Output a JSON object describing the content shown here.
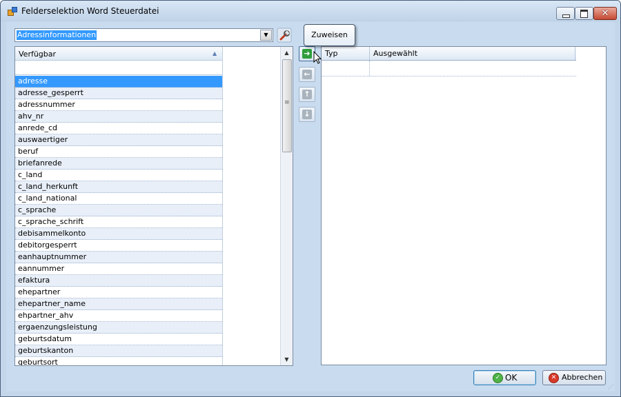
{
  "window": {
    "title": "Felderselektion Word Steuerdatei"
  },
  "combo": {
    "value": "Adressinformationen"
  },
  "list": {
    "header": "Verfügbar",
    "items": [
      "adresse",
      "adresse_gesperrt",
      "adressnummer",
      "ahv_nr",
      "anrede_cd",
      "auswaertiger",
      "beruf",
      "briefanrede",
      "c_land",
      "c_land_herkunft",
      "c_land_national",
      "c_sprache",
      "c_sprache_schrift",
      "debisammelkonto",
      "debitorgesperrt",
      "eanhauptnummer",
      "eannummer",
      "efaktura",
      "ehepartner",
      "ehepartner_name",
      "ehpartner_ahv",
      "ergaenzungsleistung",
      "geburtsdatum",
      "geburtskanton",
      "geburtsort"
    ],
    "selected_index": 0
  },
  "tooltip": {
    "text": "Zuweisen"
  },
  "grid": {
    "columns": [
      "Typ",
      "Ausgewählt"
    ]
  },
  "buttons": {
    "ok": "OK",
    "cancel": "Abbrechen"
  },
  "colors": {
    "selection": "#3399ff",
    "assign_icon": "#2f9e3c",
    "window_bg": "#c9dcef"
  }
}
